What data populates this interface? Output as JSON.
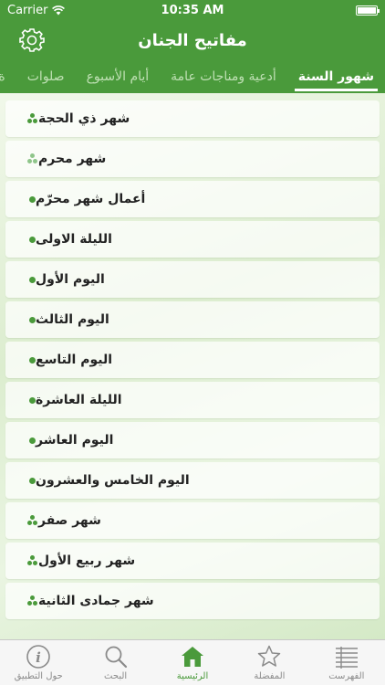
{
  "status": {
    "carrier": "Carrier",
    "time": "10:35 AM"
  },
  "nav": {
    "title": "مفاتيح الجنان"
  },
  "tabs": [
    {
      "label": "شهور السنة",
      "active": true
    },
    {
      "label": "أدعية ومناجات عامة",
      "active": false
    },
    {
      "label": "أيام الأسبوع",
      "active": false
    },
    {
      "label": "صلوات",
      "active": false
    },
    {
      "label": "ة",
      "active": false
    }
  ],
  "list": [
    {
      "label": "شهر ذي الحجة",
      "level": "top"
    },
    {
      "label": "شهر محرم",
      "level": "top-muted"
    },
    {
      "label": "أعمال شهر محرّم",
      "level": "child"
    },
    {
      "label": "الليلة الاولى",
      "level": "child"
    },
    {
      "label": "اليوم الأول",
      "level": "child"
    },
    {
      "label": "اليوم الثالث",
      "level": "child"
    },
    {
      "label": "اليوم التاسع",
      "level": "child"
    },
    {
      "label": "الليلة العاشرة",
      "level": "child"
    },
    {
      "label": "اليوم العاشر",
      "level": "child"
    },
    {
      "label": "اليوم الخامس والعشرون",
      "level": "child"
    },
    {
      "label": "شهر صفر",
      "level": "top"
    },
    {
      "label": "شهر ربيع الأول",
      "level": "top"
    },
    {
      "label": "شهر جمادى الثانية",
      "level": "top"
    }
  ],
  "tabbar": {
    "about": "حول التطبيق",
    "search": "البحث",
    "home": "الرئيسية",
    "favorites": "المفضلة",
    "index": "الفهرست"
  },
  "colors": {
    "brand": "#4a9a3b",
    "inactive": "#8a8a8a"
  }
}
